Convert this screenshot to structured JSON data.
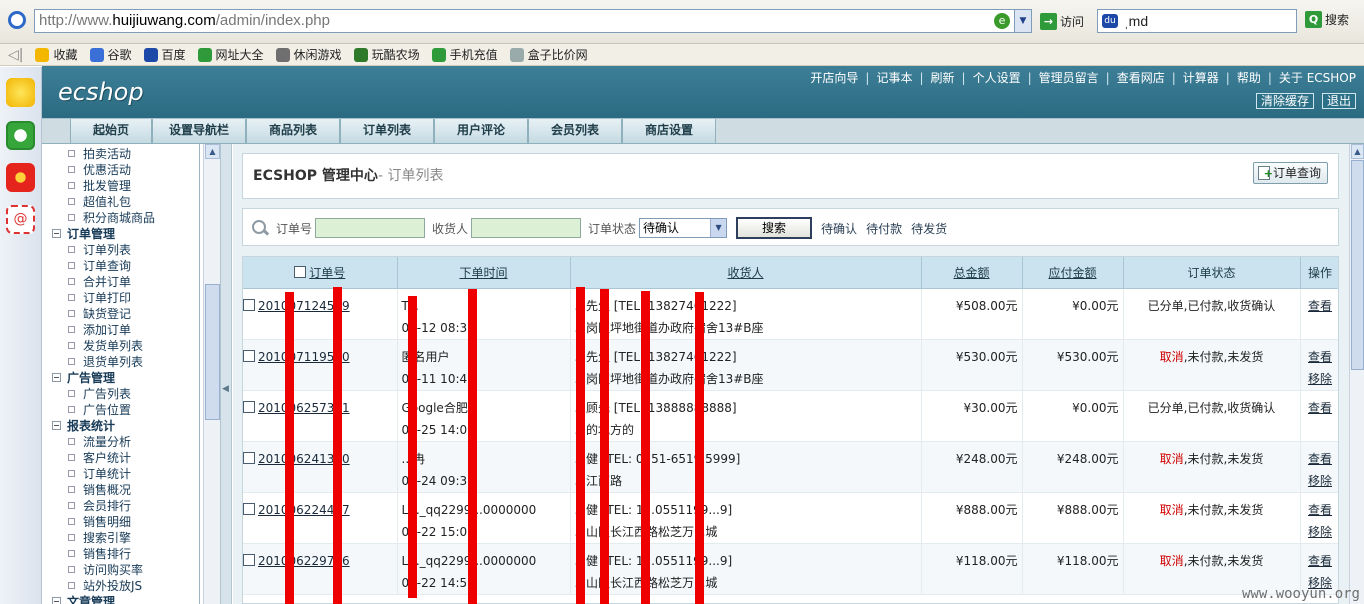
{
  "browser": {
    "url_prefix": "http://www.",
    "url_domain": "huijiuwang.com",
    "url_path": "/admin/index.php",
    "go_label": "访问",
    "search_value": "ˌmd",
    "search_label": "搜索",
    "favorites": [
      {
        "label": "收藏",
        "icon": "star-icon"
      },
      {
        "label": "谷歌",
        "icon": "google-icon"
      },
      {
        "label": "百度",
        "icon": "baidu-paw-icon"
      },
      {
        "label": "网址大全",
        "icon": "web-directory-icon"
      },
      {
        "label": "休闲游戏",
        "icon": "gamepad-icon"
      },
      {
        "label": "玩酷农场",
        "icon": "farm-icon"
      },
      {
        "label": "手机充值",
        "icon": "mobile-recharge-icon"
      },
      {
        "label": "盒子比价网",
        "icon": "page-icon"
      }
    ]
  },
  "header": {
    "logo": "ecshop",
    "top_links": [
      "开店向导",
      "记事本",
      "刷新",
      "个人设置",
      "管理员留言",
      "查看网店",
      "计算器",
      "帮助",
      "关于 ECSHOP"
    ],
    "sub_buttons": [
      "清除缓存",
      "退出"
    ]
  },
  "nav": {
    "tabs": [
      "起始页",
      "设置导航栏",
      "商品列表",
      "订单列表",
      "用户评论",
      "会员列表",
      "商店设置"
    ]
  },
  "menu": [
    {
      "label": "拍卖活动",
      "group": false
    },
    {
      "label": "优惠活动",
      "group": false
    },
    {
      "label": "批发管理",
      "group": false
    },
    {
      "label": "超值礼包",
      "group": false
    },
    {
      "label": "积分商城商品",
      "group": false
    },
    {
      "label": "订单管理",
      "group": true
    },
    {
      "label": "订单列表",
      "group": false
    },
    {
      "label": "订单查询",
      "group": false
    },
    {
      "label": "合并订单",
      "group": false
    },
    {
      "label": "订单打印",
      "group": false
    },
    {
      "label": "缺货登记",
      "group": false
    },
    {
      "label": "添加订单",
      "group": false
    },
    {
      "label": "发货单列表",
      "group": false
    },
    {
      "label": "退货单列表",
      "group": false
    },
    {
      "label": "广告管理",
      "group": true
    },
    {
      "label": "广告列表",
      "group": false
    },
    {
      "label": "广告位置",
      "group": false
    },
    {
      "label": "报表统计",
      "group": true
    },
    {
      "label": "流量分析",
      "group": false
    },
    {
      "label": "客户统计",
      "group": false
    },
    {
      "label": "订单统计",
      "group": false
    },
    {
      "label": "销售概况",
      "group": false
    },
    {
      "label": "会员排行",
      "group": false
    },
    {
      "label": "销售明细",
      "group": false
    },
    {
      "label": "搜索引擎",
      "group": false
    },
    {
      "label": "销售排行",
      "group": false
    },
    {
      "label": "访问购买率",
      "group": false
    },
    {
      "label": "站外投放JS",
      "group": false
    },
    {
      "label": "文章管理",
      "group": true
    }
  ],
  "page": {
    "title": "ECSHOP 管理中心",
    "subtitle": "- 订单列表",
    "query_button": "订单查询"
  },
  "filter": {
    "order_sn_label": "订单号",
    "consignee_label": "收货人",
    "status_label": "订单状态",
    "status_value": "待确认",
    "search_button": "搜索",
    "quick_links": [
      "待确认",
      "待付款",
      "待发货"
    ]
  },
  "table": {
    "headers": [
      "订单号",
      "下单时间",
      "收货人",
      "总金额",
      "应付金额",
      "订单状态",
      "操作"
    ],
    "rows": [
      {
        "sn": "201007124589",
        "buyer": "T...",
        "time": "07-12 08:36",
        "consignee": "...先生 [TEL: 13827461222]",
        "address": "...岗区坪地街道办政府宿舍13#B座",
        "total": "¥508.00元",
        "payable": "¥0.00元",
        "status_red": "",
        "status": "已分单,已付款,收货确认",
        "ops": [
          "查看"
        ]
      },
      {
        "sn": "201007119560",
        "buyer": "匿名用户",
        "time": "07-11 10:41",
        "consignee": "...先生 [TEL: 13827461222]",
        "address": "...岗区坪地街道办政府宿舍13#B座",
        "total": "¥530.00元",
        "payable": "¥530.00元",
        "status_red": "取消",
        "status": ",未付款,未发货",
        "ops": [
          "查看",
          "移除"
        ]
      },
      {
        "sn": "201006257311",
        "buyer": "Google合肥",
        "time": "06-25 14:09",
        "consignee": "...顾先 [TEL: 13888888888]",
        "address": "...的地方的",
        "total": "¥30.00元",
        "payable": "¥0.00元",
        "status_red": "",
        "status": "已分单,已付款,收货确认",
        "ops": [
          "查看"
        ]
      },
      {
        "sn": "201006241310",
        "buyer": "...冉",
        "time": "06-24 09:33",
        "consignee": "...健 [TEL: 0551-6519 5999]",
        "address": "...江西路",
        "total": "¥248.00元",
        "payable": "¥248.00元",
        "status_red": "取消",
        "status": ",未付款,未发货",
        "ops": [
          "查看",
          "移除"
        ]
      },
      {
        "sn": "201006224497",
        "buyer": "L..._qq2299...0000000",
        "time": "06-22 15:06",
        "consignee": "...健 [TEL: 1...0551199...9]",
        "address": "...山区长江西路松芝万...城",
        "total": "¥888.00元",
        "payable": "¥888.00元",
        "status_red": "取消",
        "status": ",未付款,未发货",
        "ops": [
          "查看",
          "移除"
        ]
      },
      {
        "sn": "201006229796",
        "buyer": "L..._qq2299...0000000",
        "time": "06-22 14:59",
        "consignee": "...健 [TEL: 1...0551199...9]",
        "address": "...山区长江西路松芝万...城",
        "total": "¥118.00元",
        "payable": "¥118.00元",
        "status_red": "取消",
        "status": ",未付款,未发货",
        "ops": [
          "查看",
          "移除"
        ]
      }
    ]
  },
  "watermark": "www.wooyun.org"
}
